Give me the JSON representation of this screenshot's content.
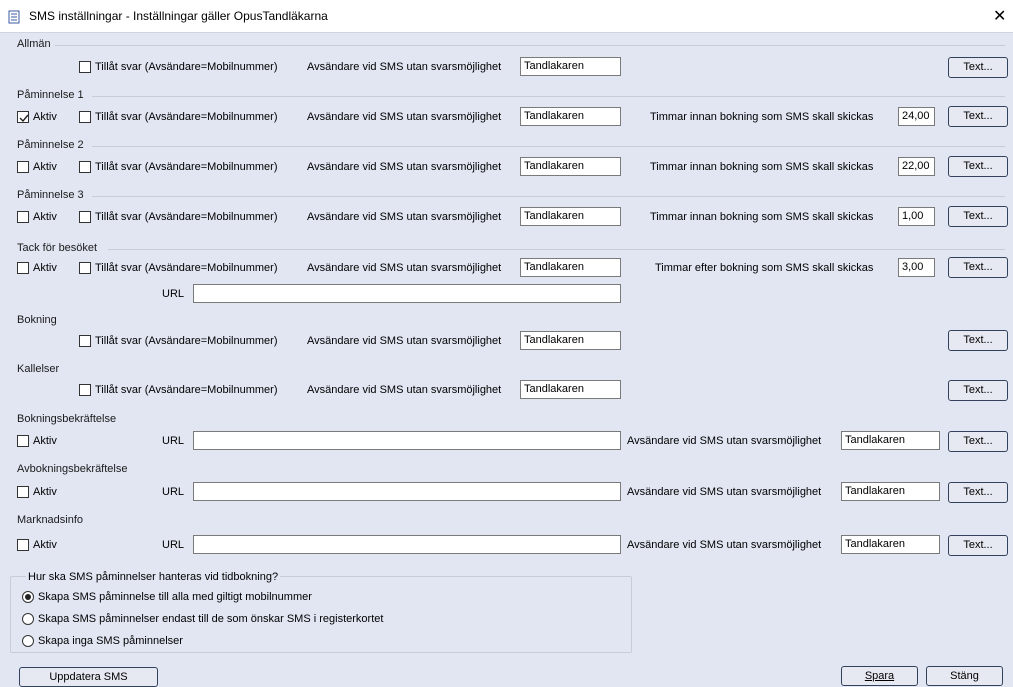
{
  "window": {
    "title": "SMS inställningar - Inställningar gäller OpusTandläkarna",
    "close_glyph": "✕"
  },
  "common": {
    "allow_reply": "Tillåt svar (Avsändare=Mobilnummer)",
    "sender": "Avsändare vid SMS utan svarsmöjlighet",
    "active": "Aktiv",
    "url": "URL",
    "text_button": "Text...",
    "sender_value": "Tandlakaren"
  },
  "sections": {
    "allman": {
      "header": "Allmän",
      "allow_reply_checked": false
    },
    "paminnelse1": {
      "header": "Påminnelse 1",
      "active_checked": true,
      "allow_reply_checked": false,
      "hours_label": "Timmar innan bokning som SMS skall skickas",
      "hours": "24,00"
    },
    "paminnelse2": {
      "header": "Påminnelse 2",
      "active_checked": false,
      "allow_reply_checked": false,
      "hours_label": "Timmar innan bokning som SMS skall skickas",
      "hours": "22,00"
    },
    "paminnelse3": {
      "header": "Påminnelse 3",
      "active_checked": false,
      "allow_reply_checked": false,
      "hours_label": "Timmar innan bokning som SMS skall skickas",
      "hours": "1,00"
    },
    "tack": {
      "header": "Tack för besöket",
      "active_checked": false,
      "allow_reply_checked": false,
      "hours_label": "Timmar efter bokning som SMS skall skickas",
      "hours": "3,00",
      "url_value": ""
    },
    "bokning": {
      "header": "Bokning",
      "allow_reply_checked": false
    },
    "kallelser": {
      "header": "Kallelser",
      "allow_reply_checked": false
    },
    "bokningsbekraftelse": {
      "header": "Bokningsbekräftelse",
      "active_checked": false,
      "url_value": ""
    },
    "avbokningsbekraftelse": {
      "header": "Avbokningsbekräftelse",
      "active_checked": false,
      "url_value": ""
    },
    "marknadsinfo": {
      "header": "Marknadsinfo",
      "active_checked": false,
      "url_value": ""
    }
  },
  "reminder_handling": {
    "question": "Hur ska SMS påminnelser hanteras vid tidbokning?",
    "options": [
      {
        "label": "Skapa SMS påminnelse till alla med giltigt mobilnummer",
        "selected": true
      },
      {
        "label": "Skapa SMS påminnelser endast till de som önskar SMS i registerkortet",
        "selected": false
      },
      {
        "label": "Skapa inga SMS påminnelser",
        "selected": false
      }
    ]
  },
  "footer": {
    "update_label": "Uppdatera SMS",
    "save_label": "Spara",
    "close_label": "Stäng"
  },
  "colors": {
    "background": "#e1e6f2",
    "button_border": "#33425c"
  },
  "icons": {
    "window": "document-icon",
    "close": "close-icon",
    "check": "checkmark-icon"
  }
}
